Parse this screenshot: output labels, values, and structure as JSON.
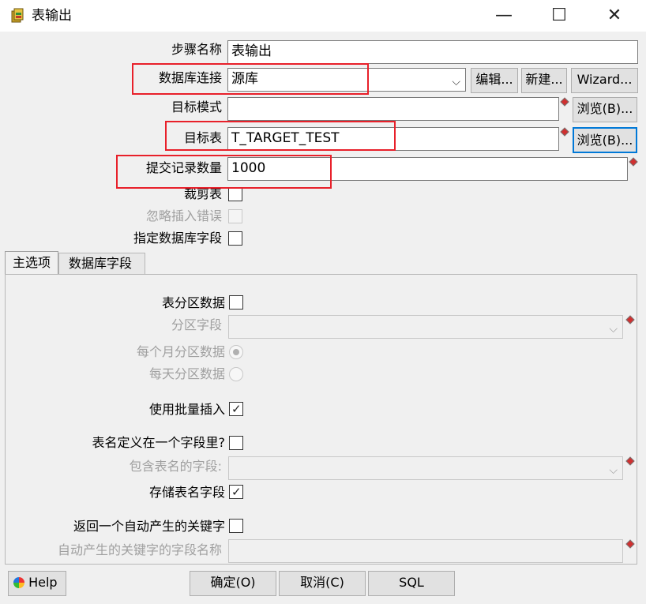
{
  "window": {
    "title": "表输出",
    "minimize": "—",
    "maximize": "☐",
    "close": "✕"
  },
  "fields": {
    "step_name": {
      "label": "步骤名称",
      "value": "表输出"
    },
    "db_connection": {
      "label": "数据库连接",
      "value": "源库",
      "edit_btn": "编辑...",
      "new_btn": "新建...",
      "wizard_btn": "Wizard..."
    },
    "target_schema": {
      "label": "目标模式",
      "value": "",
      "browse_btn": "浏览(B)..."
    },
    "target_table": {
      "label": "目标表",
      "value": "T_TARGET_TEST",
      "browse_btn": "浏览(B)..."
    },
    "commit_size": {
      "label": "提交记录数量",
      "value": "1000"
    },
    "truncate_table": {
      "label": "裁剪表",
      "checked": false
    },
    "ignore_insert_errors": {
      "label": "忽略插入错误",
      "checked": false
    },
    "specify_db_fields": {
      "label": "指定数据库字段",
      "checked": false
    }
  },
  "tabs": [
    {
      "label": "主选项",
      "active": true
    },
    {
      "label": "数据库字段",
      "active": false
    }
  ],
  "main_options": {
    "partition_data": {
      "label": "表分区数据",
      "checked": false
    },
    "partition_field": {
      "label": "分区字段",
      "value": ""
    },
    "partition_monthly": {
      "label": "每个月分区数据",
      "selected": true
    },
    "partition_daily": {
      "label": "每天分区数据",
      "selected": false
    },
    "use_batch_insert": {
      "label": "使用批量插入",
      "checked": true
    },
    "tablename_in_field": {
      "label": "表名定义在一个字段里?",
      "checked": false
    },
    "tablename_field": {
      "label": "包含表名的字段:",
      "value": ""
    },
    "store_tablename_field": {
      "label": "存储表名字段",
      "checked": true
    },
    "return_generated_key": {
      "label": "返回一个自动产生的关键字",
      "checked": false
    },
    "generated_key_field": {
      "label": "自动产生的关键字的字段名称",
      "value": ""
    }
  },
  "footer": {
    "help": "Help",
    "ok": "确定(O)",
    "cancel": "取消(C)",
    "sql": "SQL"
  },
  "colors": {
    "highlight": "#e8202a",
    "focus": "#0078d7"
  }
}
